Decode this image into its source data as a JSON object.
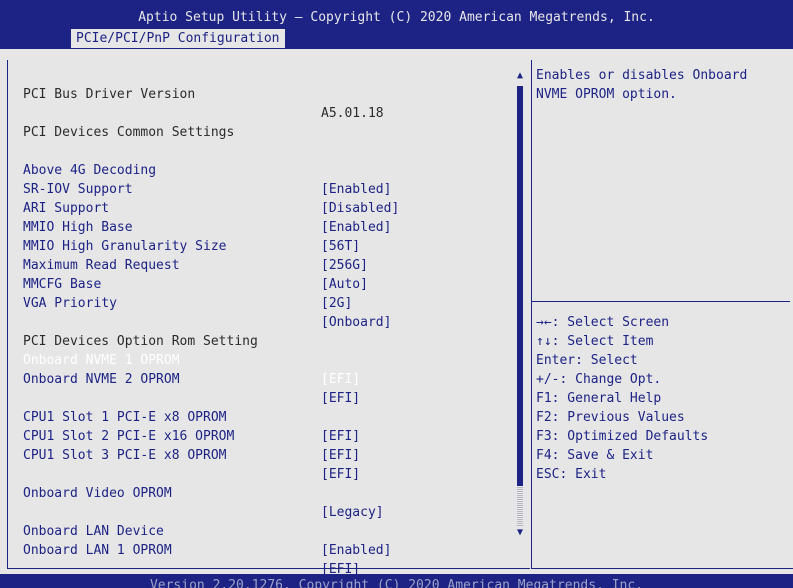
{
  "header": {
    "title": "Aptio Setup Utility – Copyright (C) 2020 American Megatrends, Inc.",
    "active_tab": "PCIe/PCI/PnP Configuration"
  },
  "settings": [
    {
      "label": "PCI Bus Driver Version",
      "value": "A5.01.18",
      "kind": "static"
    },
    {
      "label": "PCI Devices Common Settings",
      "value": "",
      "kind": "static"
    },
    {
      "label": "Above 4G Decoding",
      "value": "[Enabled]",
      "kind": "link"
    },
    {
      "label": "SR-IOV Support",
      "value": "[Disabled]",
      "kind": "link"
    },
    {
      "label": "ARI Support",
      "value": "[Enabled]",
      "kind": "link"
    },
    {
      "label": "MMIO High Base",
      "value": "[56T]",
      "kind": "link"
    },
    {
      "label": "MMIO High Granularity Size",
      "value": "[256G]",
      "kind": "link"
    },
    {
      "label": "Maximum Read Request",
      "value": "[Auto]",
      "kind": "link"
    },
    {
      "label": "MMCFG Base",
      "value": "[2G]",
      "kind": "link"
    },
    {
      "label": "VGA Priority",
      "value": "[Onboard]",
      "kind": "link"
    },
    {
      "label": "PCI Devices Option Rom Setting",
      "value": "",
      "kind": "static"
    },
    {
      "label": "Onboard NVME 1 OPROM",
      "value": "[EFI]",
      "kind": "selected"
    },
    {
      "label": "Onboard NVME 2 OPROM",
      "value": "[EFI]",
      "kind": "link"
    },
    {
      "label": "CPU1 Slot 1 PCI-E x8 OPROM",
      "value": "[EFI]",
      "kind": "link"
    },
    {
      "label": "CPU1 Slot 2 PCI-E x16 OPROM",
      "value": "[EFI]",
      "kind": "link"
    },
    {
      "label": "CPU1 Slot 3 PCI-E x8 OPROM",
      "value": "[EFI]",
      "kind": "link"
    },
    {
      "label": "Onboard Video OPROM",
      "value": "[Legacy]",
      "kind": "link"
    },
    {
      "label": "Onboard LAN Device",
      "value": "[Enabled]",
      "kind": "link"
    },
    {
      "label": "Onboard LAN 1 OPROM",
      "value": "[EFI]",
      "kind": "link"
    }
  ],
  "help": {
    "lines": [
      "Enables or disables Onboard",
      "NVME OPROM option."
    ]
  },
  "keys": [
    "→←: Select Screen",
    "↑↓: Select Item",
    "Enter: Select",
    "+/-: Change Opt.",
    "F1: General Help",
    "F2: Previous Values",
    "F3: Optimized Defaults",
    "F4: Save & Exit",
    "ESC: Exit"
  ],
  "footer": {
    "text": "Version 2.20.1276. Copyright (C) 2020 American Megatrends, Inc."
  },
  "icons": {
    "scroll_up": "▲",
    "scroll_down": "▼"
  },
  "colors": {
    "background": "#e6e6e6",
    "accent_blue": "#1d2385",
    "selected_text": "#ffffff"
  }
}
